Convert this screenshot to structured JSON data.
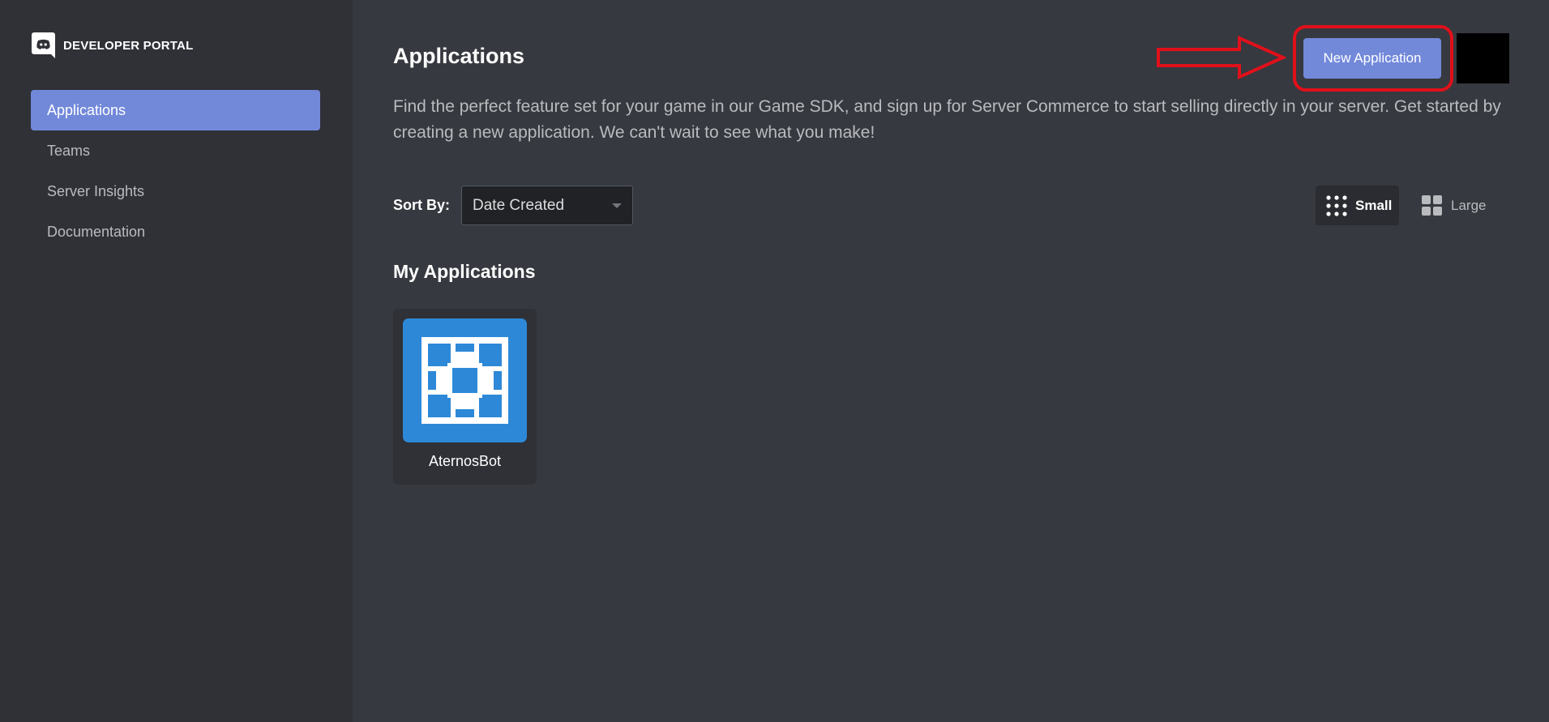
{
  "brand": {
    "title": "DEVELOPER PORTAL",
    "logo_icon": "discord-logo-icon"
  },
  "sidebar": {
    "items": [
      {
        "label": "Applications",
        "active": true
      },
      {
        "label": "Teams",
        "active": false
      },
      {
        "label": "Server Insights",
        "active": false
      },
      {
        "label": "Documentation",
        "active": false
      }
    ]
  },
  "header": {
    "title": "Applications",
    "description": "Find the perfect feature set for your game in our Game SDK, and sign up for Server Commerce to start selling directly in your server. Get started by creating a new application. We can't wait to see what you make!",
    "new_app_label": "New Application"
  },
  "sort": {
    "label": "Sort By:",
    "value": "Date Created"
  },
  "view": {
    "small_label": "Small",
    "large_label": "Large",
    "selected": "small"
  },
  "section": {
    "title": "My Applications"
  },
  "apps": [
    {
      "name": "AternosBot",
      "icon": "aternos-icon"
    }
  ],
  "colors": {
    "accent": "#7289da",
    "sidebar_bg": "#2f3136",
    "main_bg": "#36393f",
    "annotation": "#e0101a",
    "app_icon_bg": "#2d89d8"
  }
}
